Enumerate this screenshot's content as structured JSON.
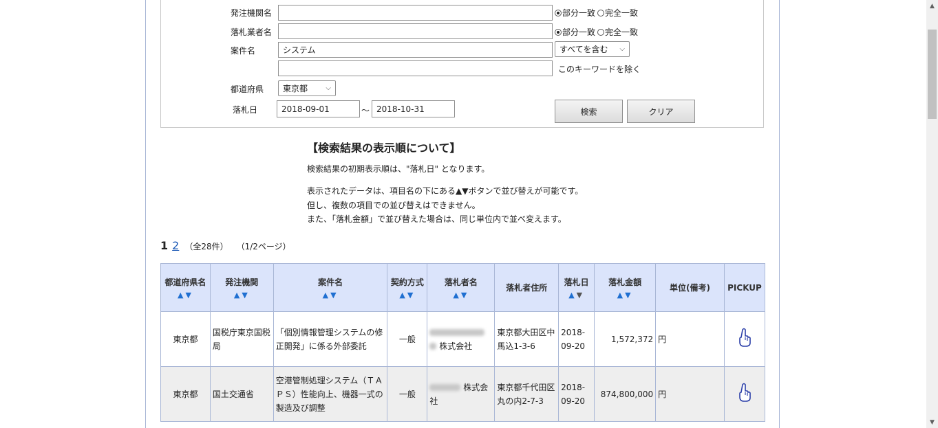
{
  "search": {
    "agency_label": "発注機関名",
    "bidder_label": "落札業者名",
    "project_label": "案件名",
    "prefecture_label": "都道府県",
    "date_label": "落札日",
    "partial_match": "部分一致",
    "exact_match": "完全一致",
    "project_value": "システム",
    "include_select": "すべてを含む",
    "exclude_keyword": "このキーワードを除く",
    "prefecture_value": "東京都",
    "date_from": "2018-09-01",
    "date_sep": "～",
    "date_to": "2018-10-31",
    "search_button": "検索",
    "clear_button": "クリア"
  },
  "about": {
    "title": "【検索結果の表示順について】",
    "line1": "検索結果の初期表示順は、\"落札日\" となります。",
    "line2": "表示されたデータは、項目名の下にある▲▼ボタンで並び替えが可能です。",
    "line3": "但し、複数の項目での並び替えはできません。",
    "line4": "また、「落札金額」で並び替えた場合は、同じ単位内で並べ変えます。"
  },
  "pager": {
    "current": "1",
    "next": "2",
    "total": "（全28件）",
    "page_info": "（1/2ページ）"
  },
  "table": {
    "headers": [
      "都道府県名",
      "発注機関",
      "案件名",
      "契約方式",
      "落札者名",
      "落札者住所",
      "落札日",
      "落札金額",
      "単位(備考)",
      "PICKUP"
    ],
    "sort_up": "▲",
    "sort_down": "▼",
    "rows": [
      {
        "pref": "東京都",
        "agency": "国税庁東京国税局",
        "project": "「個別情報管理システムの修正開発」に係る外部委託",
        "method": "一般",
        "bidder": "株式会社",
        "address": "東京都大田区中馬込1-3-6",
        "date": "2018-09-20",
        "amount": "1,572,372",
        "unit": "円"
      },
      {
        "pref": "東京都",
        "agency": "国土交通省",
        "project": "空港管制処理システム（ＴＡＰＳ）性能向上、機器一式の製造及び調整",
        "method": "一般",
        "bidder": "株式会社",
        "address": "東京都千代田区丸の内2-7-3",
        "date": "2018-09-20",
        "amount": "874,800,000",
        "unit": "円"
      }
    ]
  }
}
